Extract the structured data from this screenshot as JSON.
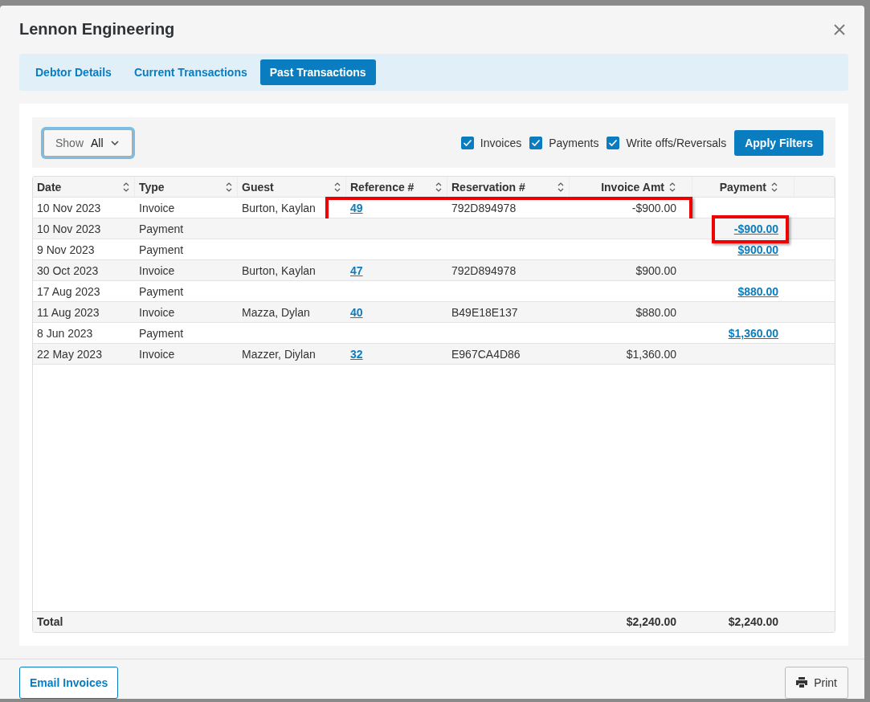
{
  "dialog": {
    "title": "Lennon Engineering"
  },
  "tabs": [
    {
      "label": "Debtor Details",
      "selected": false
    },
    {
      "label": "Current Transactions",
      "selected": false
    },
    {
      "label": "Past Transactions",
      "selected": true
    }
  ],
  "filters": {
    "show_label": "Show",
    "show_value": "All",
    "options": [
      {
        "label": "Invoices",
        "checked": true
      },
      {
        "label": "Payments",
        "checked": true
      },
      {
        "label": "Write offs/Reversals",
        "checked": true
      }
    ],
    "apply_button": "Apply Filters"
  },
  "table": {
    "columns": [
      {
        "label": "Date"
      },
      {
        "label": "Type"
      },
      {
        "label": "Guest"
      },
      {
        "label": "Reference #"
      },
      {
        "label": "Reservation #"
      },
      {
        "label": "Invoice Amt"
      },
      {
        "label": "Payment"
      }
    ],
    "rows": [
      {
        "date": "10 Nov 2023",
        "type": "Invoice",
        "guest": "Burton, Kaylan",
        "reference": "49",
        "reservation": "792D894978",
        "invoice_amt": "-$900.00",
        "payment": "",
        "highlighted": true
      },
      {
        "date": "10 Nov 2023",
        "type": "Payment",
        "guest": "",
        "reference": "",
        "reservation": "",
        "invoice_amt": "",
        "payment": "-$900.00",
        "highlighted": true
      },
      {
        "date": "9 Nov 2023",
        "type": "Payment",
        "guest": "",
        "reference": "",
        "reservation": "",
        "invoice_amt": "",
        "payment": "$900.00",
        "highlighted": false
      },
      {
        "date": "30 Oct 2023",
        "type": "Invoice",
        "guest": "Burton, Kaylan",
        "reference": "47",
        "reservation": "792D894978",
        "invoice_amt": "$900.00",
        "payment": "",
        "highlighted": false
      },
      {
        "date": "17 Aug 2023",
        "type": "Payment",
        "guest": "",
        "reference": "",
        "reservation": "",
        "invoice_amt": "",
        "payment": "$880.00",
        "highlighted": false
      },
      {
        "date": "11 Aug 2023",
        "type": "Invoice",
        "guest": "Mazza, Dylan",
        "reference": "40",
        "reservation": "B49E18E137",
        "invoice_amt": "$880.00",
        "payment": "",
        "highlighted": false
      },
      {
        "date": "8 Jun 2023",
        "type": "Payment",
        "guest": "",
        "reference": "",
        "reservation": "",
        "invoice_amt": "",
        "payment": "$1,360.00",
        "highlighted": false
      },
      {
        "date": "22 May 2023",
        "type": "Invoice",
        "guest": "Mazzer, Diylan",
        "reference": "32",
        "reservation": "E967CA4D86",
        "invoice_amt": "$1,360.00",
        "payment": "",
        "highlighted": false
      }
    ],
    "total": {
      "label": "Total",
      "invoice_amt": "$2,240.00",
      "payment": "$2,240.00"
    }
  },
  "footer": {
    "email_button": "Email Invoices",
    "print_button": "Print"
  }
}
